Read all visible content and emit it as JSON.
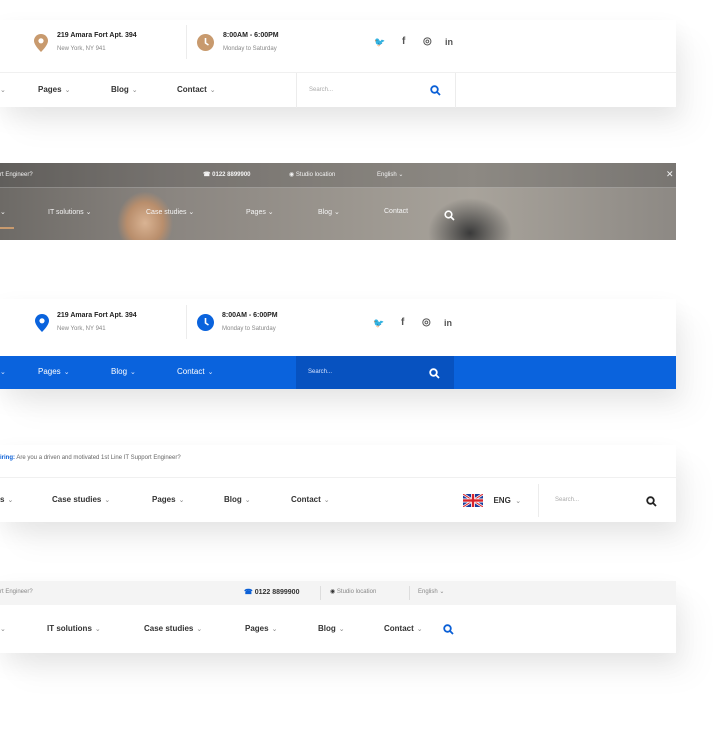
{
  "colors": {
    "accent_blue": "#0a5fd6",
    "pin_tan": "#c89a6e",
    "hero_blue": "#0a63dd"
  },
  "header1": {
    "address_line1": "219 Amara Fort Apt. 394",
    "address_line2": "New York, NY 941",
    "hours_line1": "8:00AM - 6:00PM",
    "hours_line2": "Monday to Saturday",
    "social": [
      "twitter-icon",
      "facebook-icon",
      "instagram-icon",
      "linkedin-icon"
    ],
    "social_glyphs": [
      "✦",
      "f",
      "◎",
      "in"
    ],
    "menu": [
      "Pages",
      "Blog",
      "Contact"
    ],
    "search_placeholder": "Search..."
  },
  "header2": {
    "topbar_text": "rt Engineer?",
    "phone": "0122 8899900",
    "location": "Studio location",
    "language": "English",
    "menu": [
      "IT solutions",
      "Case studies",
      "Pages",
      "Blog",
      "Contact"
    ]
  },
  "header3": {
    "address_line1": "219 Amara Fort Apt. 394",
    "address_line2": "New York, NY 941",
    "hours_line1": "8:00AM - 6:00PM",
    "hours_line2": "Monday to Saturday",
    "social_glyphs": [
      "✦",
      "f",
      "◎",
      "in"
    ],
    "menu": [
      "Pages",
      "Blog",
      "Contact"
    ],
    "search_placeholder": "Search..."
  },
  "header4": {
    "hiring_label": "iring:",
    "hiring_text": "Are you a driven and motivated 1st Line IT Support Engineer?",
    "menu": [
      "s",
      "Case studies",
      "Pages",
      "Blog",
      "Contact"
    ],
    "language": "ENG",
    "search_placeholder": "Search..."
  },
  "header5": {
    "topbar_text": "rt Engineer?",
    "phone": "0122 8899900",
    "location": "Studio location",
    "language": "English",
    "menu": [
      "IT solutions",
      "Case studies",
      "Pages",
      "Blog",
      "Contact"
    ]
  }
}
